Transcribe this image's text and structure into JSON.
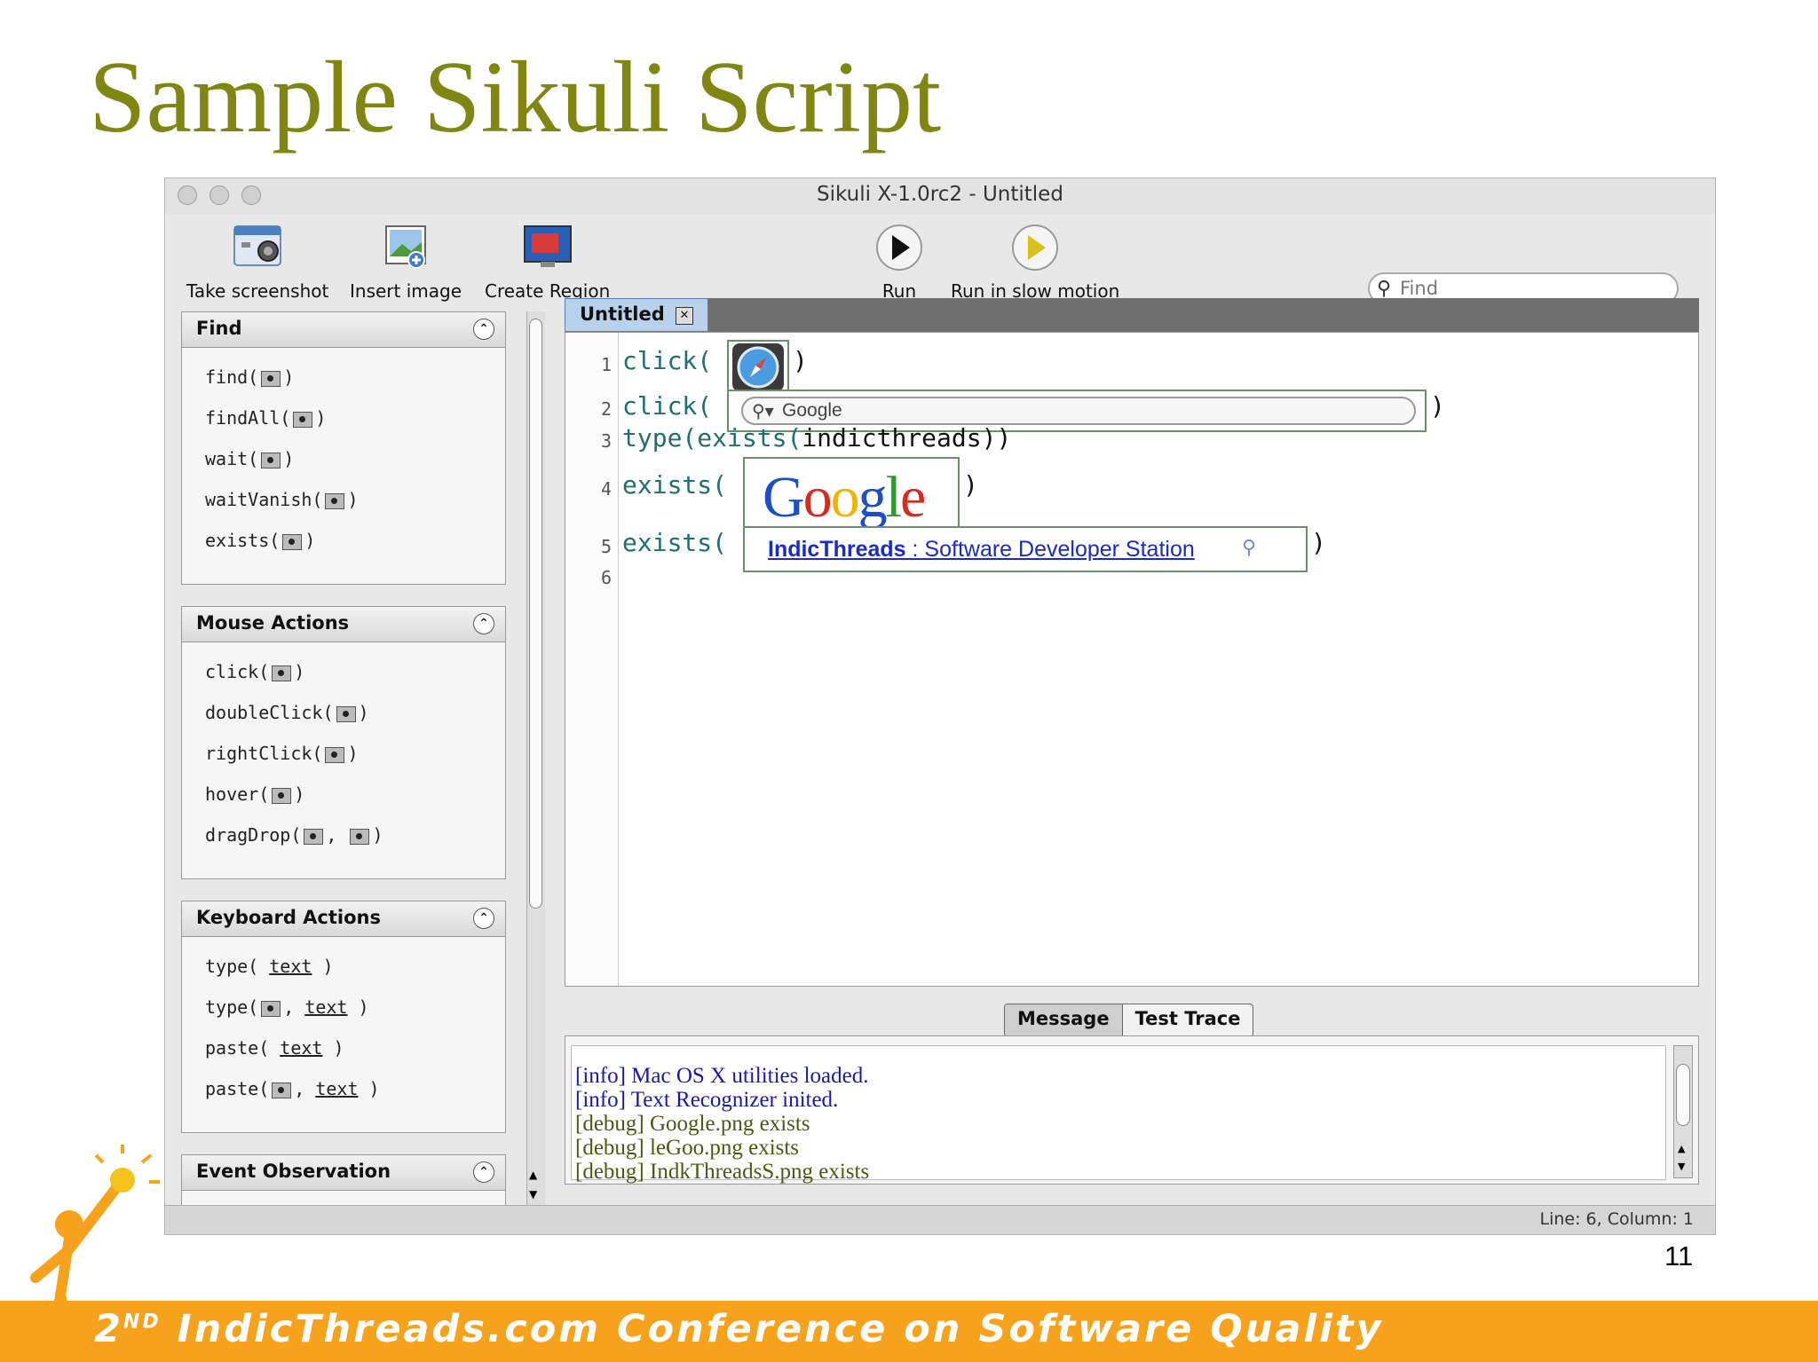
{
  "slide": {
    "title": "Sample Sikuli Script",
    "page_number": "11",
    "footer": {
      "prefix": "2",
      "sup": "ND",
      "text": "IndicThreads.com Conference on Software Quality"
    },
    "colors": {
      "title": "#7f8611",
      "footer": "#f6a21d"
    }
  },
  "window": {
    "title": "Sikuli X-1.0rc2 - Untitled",
    "toolbar": {
      "take_screenshot": "Take screenshot",
      "insert_image": "Insert image",
      "create_region": "Create Region",
      "run": "Run",
      "run_slow": "Run in slow motion",
      "find_placeholder": "Find"
    },
    "sidebar": {
      "find": {
        "title": "Find",
        "items": [
          "find(",
          "findAll(",
          "wait(",
          "waitVanish(",
          "exists("
        ]
      },
      "mouse": {
        "title": "Mouse Actions",
        "items": [
          "click(",
          "doubleClick(",
          "rightClick(",
          "hover(",
          "dragDrop("
        ]
      },
      "keyboard": {
        "title": "Keyboard Actions",
        "items": [
          "type(",
          "type(",
          "paste(",
          "paste("
        ],
        "text_word": "text"
      },
      "event": {
        "title": "Event Observation"
      }
    },
    "editor": {
      "tab": "Untitled",
      "line_numbers": [
        "1",
        "2",
        "3",
        "4",
        "5",
        "6"
      ],
      "lines": {
        "l1": "click(",
        "l2": "click(",
        "l3_type": "type(",
        "l3_exists": "exists(",
        "l3_arg": "indicthreads))",
        "l4": "exists(",
        "l5": "exists("
      },
      "images": {
        "search_field_text": "Google",
        "logo_text": "Google",
        "link_bold": "IndicThreads",
        "link_rest": " : Software Developer Station"
      }
    },
    "console": {
      "tabs": [
        "Message",
        "Test Trace"
      ],
      "lines": [
        "[info] Mac OS X utilities loaded.",
        "[info] Text Recognizer inited.",
        "[debug] Google.png exists",
        "[debug] leGoo.png exists",
        "[debug] IndkThreadsS.png exists"
      ],
      "colors": {
        "info": "#1a1aa6",
        "debug": "#4a5a10"
      }
    },
    "status": "Line: 6, Column: 1"
  }
}
